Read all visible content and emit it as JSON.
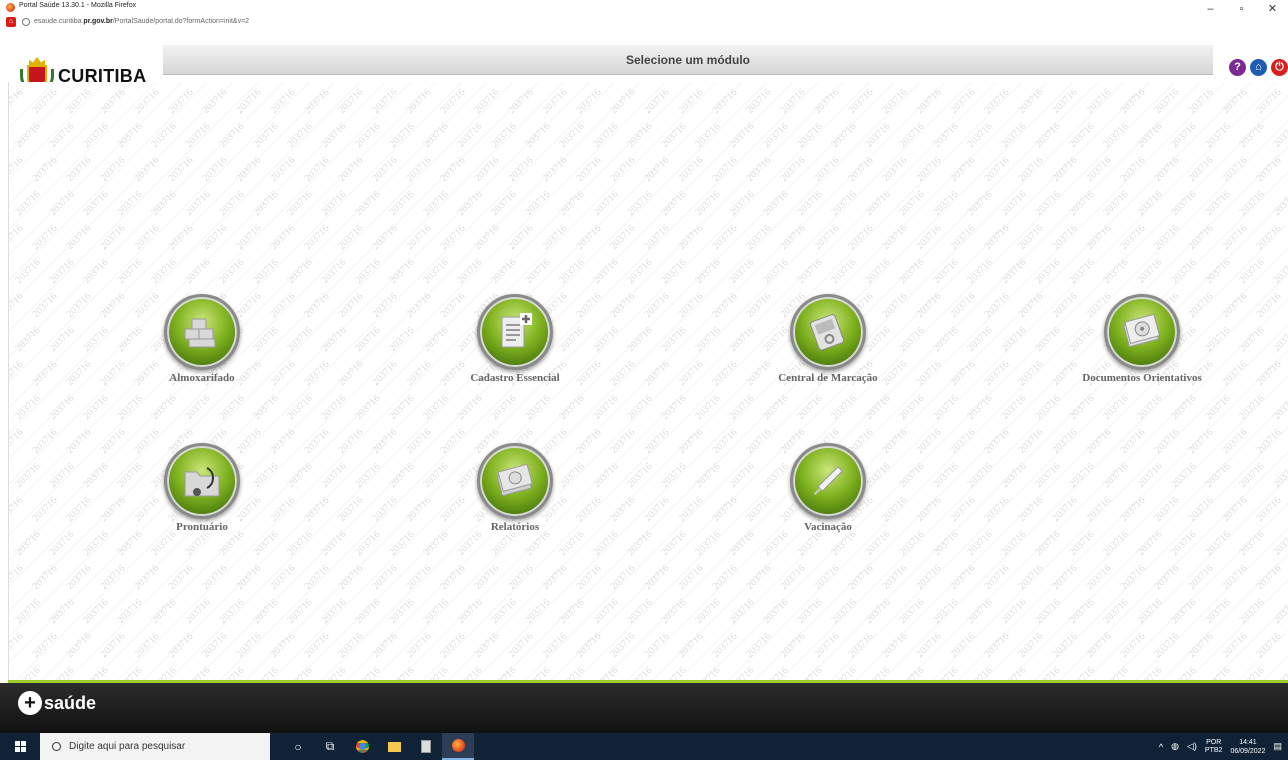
{
  "browser": {
    "window_title": "Portal Saúde 13.30.1 - Mozilla Firefox",
    "url_prefix": "esaude.curitiba.",
    "url_domain": "pr.gov.br",
    "url_path": "/PortalSaude/portal.do?formAction=init&v=2",
    "controls": {
      "minimize": "–",
      "restore": "▫",
      "close": "✕"
    }
  },
  "header": {
    "logo_text": "CURITIBA",
    "title": "Selecione um módulo",
    "icons": [
      "help-icon",
      "lock-icon",
      "power-icon"
    ]
  },
  "watermark_text": "203716",
  "modules": [
    {
      "label": "Almoxarifado",
      "icon": "warehouse-boxes-icon"
    },
    {
      "label": "Cadastro Essencial",
      "icon": "document-add-icon"
    },
    {
      "label": "Central de Marcação",
      "icon": "scheduling-device-icon"
    },
    {
      "label": "Documentos Orientativos",
      "icon": "documents-disc-icon"
    },
    {
      "label": "Prontuário",
      "icon": "folder-stethoscope-icon"
    },
    {
      "label": "Relatórios",
      "icon": "reports-stack-icon"
    },
    {
      "label": "Vacinação",
      "icon": "syringe-icon"
    }
  ],
  "footer": {
    "logo_text": "saúde"
  },
  "taskbar": {
    "search_placeholder": "Digite aqui para pesquisar",
    "lang_top": "POR",
    "lang_bottom": "PTB2",
    "time": "14:41",
    "date": "06/09/2022"
  },
  "colors": {
    "module_green": "#7fb21f",
    "footer_accent": "#9ccc2a",
    "brand_red": "#c4161c"
  }
}
